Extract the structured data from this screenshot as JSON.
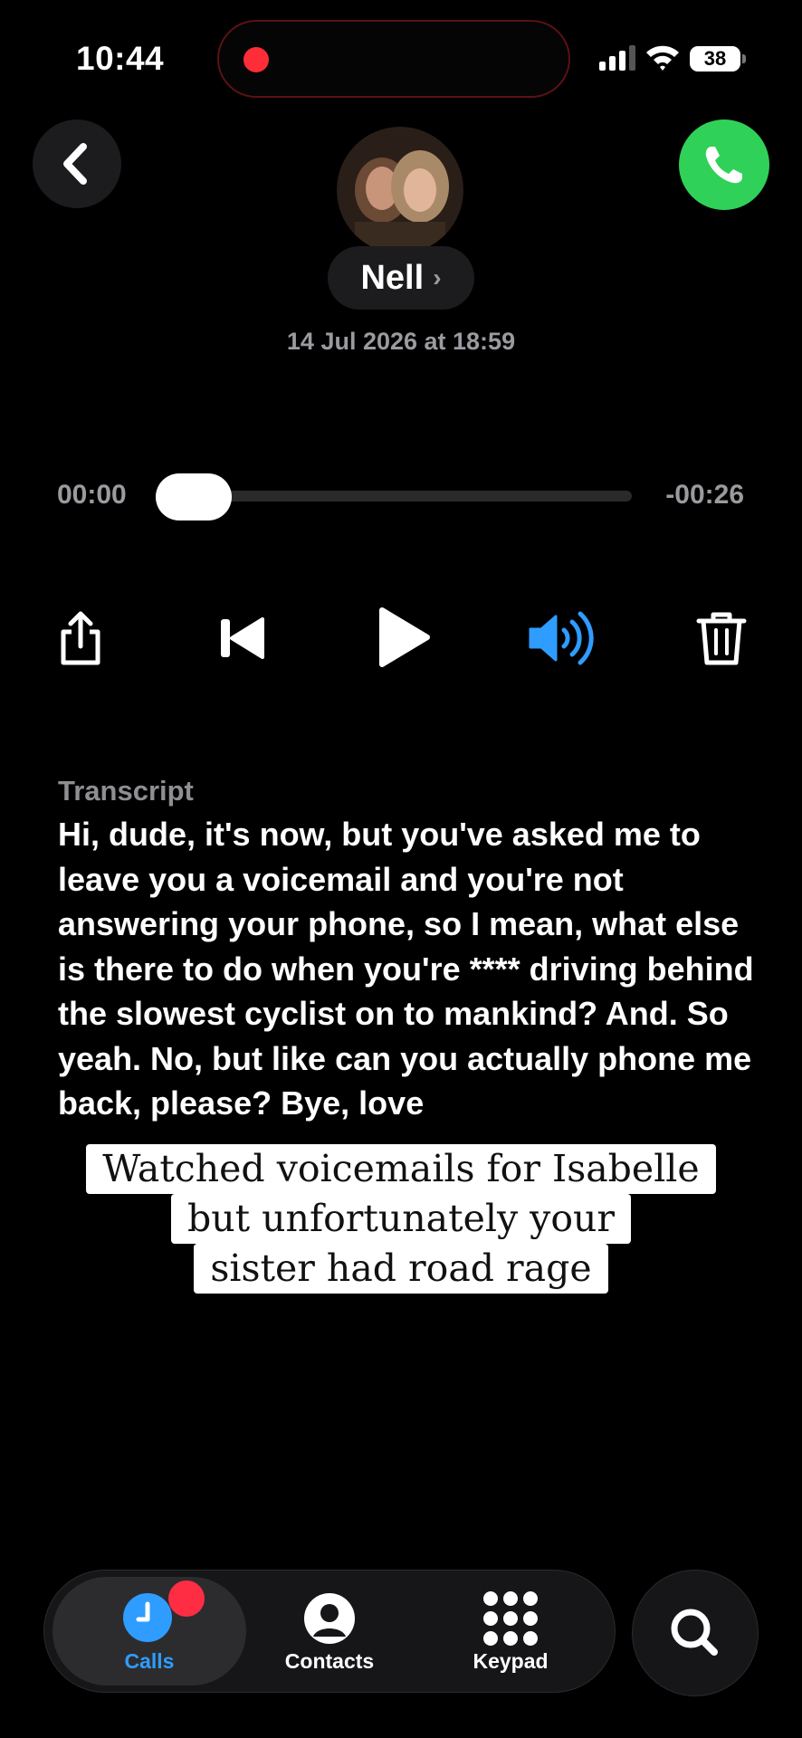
{
  "status_bar": {
    "time": "10:44",
    "battery": "38"
  },
  "contact": {
    "name": "Nell",
    "chevron": "›",
    "date": "14 Jul 2026 at 18:59"
  },
  "playback": {
    "elapsed": "00:00",
    "remaining": "-00:26",
    "progress": 0
  },
  "controls": {
    "share": "share-icon",
    "skip_back": "skip-back-icon",
    "play": "play-icon",
    "speaker": "speaker-icon",
    "delete": "trash-icon"
  },
  "transcript": {
    "label": "Transcript",
    "text": "Hi, dude, it's now, but you've asked me to leave you a voicemail and you're not answering your phone, so I mean, what else is there to do when you're **** driving behind the slowest cyclist on to mankind? And.  So yeah.  No, but like can you actually phone me back, please?  Bye, love"
  },
  "caption": {
    "lines": [
      "Watched voicemails for Isabelle",
      "but unfortunately your",
      "sister had road rage"
    ]
  },
  "tab_bar": {
    "tabs": [
      {
        "label": "Calls",
        "icon": "clock-icon",
        "active": true
      },
      {
        "label": "Contacts",
        "icon": "person-icon",
        "active": false
      },
      {
        "label": "Keypad",
        "icon": "keypad-icon",
        "active": false
      }
    ]
  },
  "colors": {
    "accent": "#2f9cff",
    "call": "#30d158",
    "badge": "#ff2d44"
  }
}
